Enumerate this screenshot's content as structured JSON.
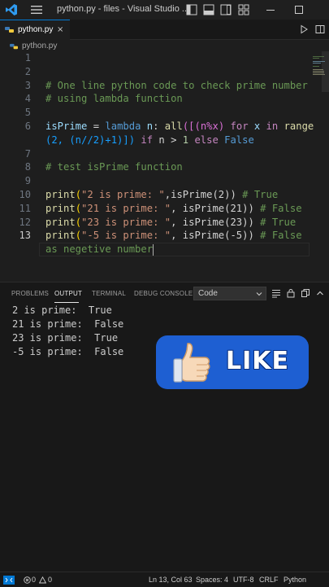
{
  "window": {
    "title": "python.py - files - Visual Studio ..."
  },
  "tab": {
    "label": "python.py",
    "close": "×"
  },
  "breadcrumb": {
    "file": "python.py"
  },
  "editor": {
    "line_numbers": [
      "1",
      "2",
      "3",
      "4",
      "5",
      "6",
      "",
      "7",
      "8",
      "9",
      "10",
      "11",
      "12",
      "13",
      ""
    ],
    "active_line": "13",
    "code": {
      "l3": "# One line python code to check prime number",
      "l4": "# using lambda function",
      "l6a_var": "isPrime",
      "l6a_eq": " = ",
      "l6a_kw": "lambda",
      "l6a_n": " n",
      "l6a_colon": ": ",
      "l6a_all": "all",
      "l6a_open": "([(n%x) ",
      "l6a_for": "for",
      "l6a_x": " x ",
      "l6a_in": "in",
      "l6a_range": " range",
      "l6b_a": "(2, (n//2)+1)])",
      "l6b_if": " if",
      "l6b_mid": " n > ",
      "l6b_one": "1",
      "l6b_else": " else",
      "l6b_false": " False",
      "l8": "# test isPrime function",
      "l10_print": "print",
      "l10_str": "\"2 is prime: \"",
      "l10_rest": ",isPrime(2))",
      "l10_com": " # True",
      "l11_print": "print",
      "l11_str": "\"21 is prime: \"",
      "l11_rest": ", isPrime(21))",
      "l11_com": " # False",
      "l12_print": "print",
      "l12_str": "\"23 is prime: \"",
      "l12_rest": ", isPrime(23))",
      "l12_com": " # True",
      "l13_print": "print",
      "l13_str": "\"-5 is prime: \"",
      "l13_rest": ", isPrime(-5))",
      "l13_com": " # False",
      "l13b_com": "as negetive number"
    }
  },
  "panel": {
    "tabs": [
      "PROBLEMS",
      "OUTPUT",
      "TERMINAL",
      "DEBUG CONSOLE"
    ],
    "active_tab": "OUTPUT",
    "channel": "Code",
    "output": [
      "2 is prime:  True",
      "21 is prime:  False",
      "23 is prime:  True",
      "-5 is prime:  False"
    ]
  },
  "sticker": {
    "label": "LIKE"
  },
  "statusbar": {
    "errors": "0",
    "warnings": "0",
    "position": "Ln 13, Col 63",
    "spaces": "Spaces: 4",
    "encoding": "UTF-8",
    "eol": "CRLF",
    "language": "Python"
  },
  "colors": {
    "accent": "#0078d4",
    "comment": "#6a9955",
    "keyword": "#569cd6",
    "string": "#ce9178",
    "sticker_bg": "#1e5fd2"
  }
}
